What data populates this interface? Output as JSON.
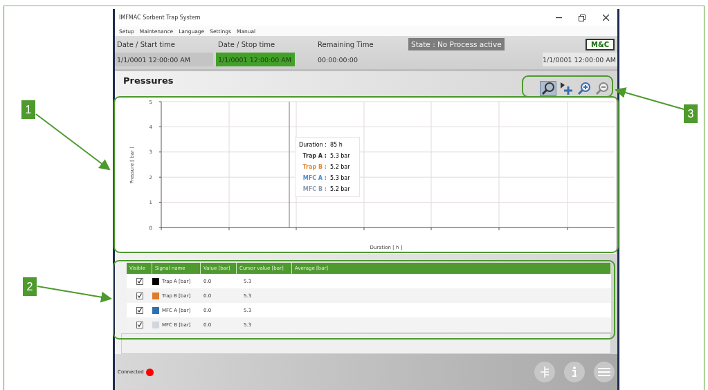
{
  "window": {
    "title": "IMFMAC Sorbent Trap System"
  },
  "menu": [
    "Setup",
    "Maintenance",
    "Language",
    "Settings",
    "Manual"
  ],
  "header": {
    "labels": [
      "Date / Start time",
      "Date / Stop time",
      "Remaining Time"
    ],
    "state": "State : No Process active",
    "logo": "M&C",
    "values": [
      {
        "text": "1/1/0001 12:00:00 AM",
        "kind": "plain"
      },
      {
        "text": "1/1/0001 12:00:00 AM",
        "kind": "highlight"
      },
      {
        "text": "00:00:00:00",
        "kind": "blank"
      }
    ],
    "clock": "1/1/0001 12:00:00 AM"
  },
  "panel": {
    "title": "Pressures",
    "tools": [
      {
        "kind": "zoom",
        "selected": true
      },
      {
        "kind": "pan",
        "selected": false
      },
      {
        "kind": "zoom-in",
        "selected": false
      },
      {
        "kind": "zoom-out",
        "selected": false
      }
    ],
    "plot": {
      "xlabel": "Duration [ h ]",
      "ylabel": "Pressure [ bar ]",
      "y_tick_labels": [
        "5",
        "4",
        "3",
        "2",
        "1",
        "0"
      ]
    },
    "cursor": {
      "label": "Duration :",
      "value": "85 h",
      "readings": [
        {
          "name": "Trap A :",
          "value": "5.3 bar",
          "color": "#333333"
        },
        {
          "name": "Trap B :",
          "value": "5.2 bar",
          "color": "#e08a3c"
        },
        {
          "name": "MFC A :",
          "value": "5.3 bar",
          "color": "#4f8fcf"
        },
        {
          "name": "MFC B :",
          "value": "5.2 bar",
          "color": "#8f9ab0"
        }
      ]
    }
  },
  "table": {
    "columns": [
      "Visible",
      "Signal name",
      "Value [bar]",
      "Cursor value [bar]",
      "Average [bar]"
    ],
    "rows": [
      {
        "visible": true,
        "color": "#000000",
        "name": "Trap A [bar]",
        "value": "0.0",
        "cursor": "5.3"
      },
      {
        "visible": true,
        "color": "#e07b2a",
        "name": "Trap B [bar]",
        "value": "0.0",
        "cursor": "5.3"
      },
      {
        "visible": true,
        "color": "#2f6fb0",
        "name": "MFC A [bar]",
        "value": "0.0",
        "cursor": "5.3"
      },
      {
        "visible": true,
        "color": "#d4d6de",
        "name": "MFC B [bar]",
        "value": "0.0",
        "cursor": "5.3"
      }
    ]
  },
  "status": {
    "label": "Connected",
    "connected": false
  },
  "callouts": [
    "1",
    "2",
    "3"
  ]
}
